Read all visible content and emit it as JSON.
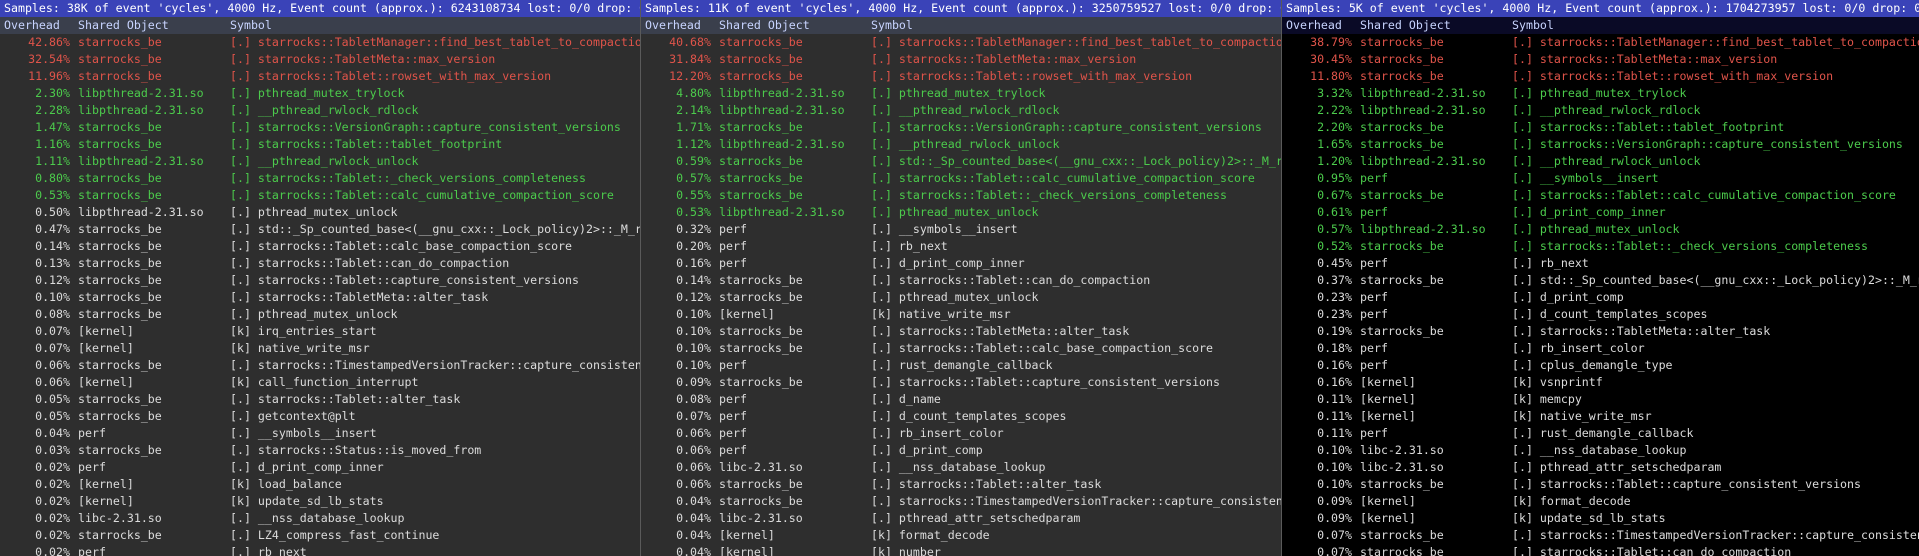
{
  "columns": {
    "overhead": "Overhead",
    "object": "Shared Object",
    "symbol": "Symbol"
  },
  "panes": [
    {
      "samples": "Samples: 38K of event 'cycles', 4000 Hz, Event count (approx.): 6243108734 lost: 0/0 drop: 0/0",
      "rows": [
        [
          "42.86%",
          "starrocks_be",
          "[.] starrocks::TabletManager::find_best_tablet_to_compaction",
          "red"
        ],
        [
          "32.54%",
          "starrocks_be",
          "[.] starrocks::TabletMeta::max_version",
          "red"
        ],
        [
          "11.96%",
          "starrocks_be",
          "[.] starrocks::Tablet::rowset_with_max_version",
          "red"
        ],
        [
          "2.30%",
          "libpthread-2.31.so",
          "[.] pthread_mutex_trylock",
          "green"
        ],
        [
          "2.28%",
          "libpthread-2.31.so",
          "[.] __pthread_rwlock_rdlock",
          "green"
        ],
        [
          "1.47%",
          "starrocks_be",
          "[.] starrocks::VersionGraph::capture_consistent_versions",
          "green"
        ],
        [
          "1.16%",
          "starrocks_be",
          "[.] starrocks::Tablet::tablet_footprint",
          "green"
        ],
        [
          "1.11%",
          "libpthread-2.31.so",
          "[.] __pthread_rwlock_unlock",
          "green"
        ],
        [
          "0.80%",
          "starrocks_be",
          "[.] starrocks::Tablet::_check_versions_completeness",
          "green"
        ],
        [
          "0.53%",
          "starrocks_be",
          "[.] starrocks::Tablet::calc_cumulative_compaction_score",
          "green"
        ],
        [
          "0.50%",
          "libpthread-2.31.so",
          "[.] pthread_mutex_unlock",
          "plain"
        ],
        [
          "0.47%",
          "starrocks_be",
          "[.] std::_Sp_counted_base<(__gnu_cxx::_Lock_policy)2>::_M_release",
          "plain"
        ],
        [
          "0.14%",
          "starrocks_be",
          "[.] starrocks::Tablet::calc_base_compaction_score",
          "plain"
        ],
        [
          "0.13%",
          "starrocks_be",
          "[.] starrocks::Tablet::can_do_compaction",
          "plain"
        ],
        [
          "0.12%",
          "starrocks_be",
          "[.] starrocks::Tablet::capture_consistent_versions",
          "plain"
        ],
        [
          "0.10%",
          "starrocks_be",
          "[.] starrocks::TabletMeta::alter_task",
          "plain"
        ],
        [
          "0.08%",
          "starrocks_be",
          "[.] pthread_mutex_unlock",
          "plain"
        ],
        [
          "0.07%",
          "[kernel]",
          "[k] irq_entries_start",
          "plain"
        ],
        [
          "0.07%",
          "[kernel]",
          "[k] native_write_msr",
          "plain"
        ],
        [
          "0.06%",
          "starrocks_be",
          "[.] starrocks::TimestampedVersionTracker::capture_consistent_versions",
          "plain"
        ],
        [
          "0.06%",
          "[kernel]",
          "[k] call_function_interrupt",
          "plain"
        ],
        [
          "0.05%",
          "starrocks_be",
          "[.] starrocks::Tablet::alter_task",
          "plain"
        ],
        [
          "0.05%",
          "starrocks_be",
          "[.] getcontext@plt",
          "plain"
        ],
        [
          "0.04%",
          "perf",
          "[.] __symbols__insert",
          "plain"
        ],
        [
          "0.03%",
          "starrocks_be",
          "[.] starrocks::Status::is_moved_from",
          "plain"
        ],
        [
          "0.02%",
          "perf",
          "[.] d_print_comp_inner",
          "plain"
        ],
        [
          "0.02%",
          "[kernel]",
          "[k] load_balance",
          "plain"
        ],
        [
          "0.02%",
          "[kernel]",
          "[k] update_sd_lb_stats",
          "plain"
        ],
        [
          "0.02%",
          "libc-2.31.so",
          "[.] __nss_database_lookup",
          "plain"
        ],
        [
          "0.02%",
          "starrocks_be",
          "[.] LZ4_compress_fast_continue",
          "plain"
        ],
        [
          "0.02%",
          "perf",
          "[.] rb_next",
          "plain"
        ]
      ]
    },
    {
      "samples": "Samples: 11K of event 'cycles', 4000 Hz, Event count (approx.): 3250759527 lost: 0/0 drop: 0/0",
      "rows": [
        [
          "40.68%",
          "starrocks_be",
          "[.] starrocks::TabletManager::find_best_tablet_to_compaction",
          "red"
        ],
        [
          "31.84%",
          "starrocks_be",
          "[.] starrocks::TabletMeta::max_version",
          "red"
        ],
        [
          "12.20%",
          "starrocks_be",
          "[.] starrocks::Tablet::rowset_with_max_version",
          "red"
        ],
        [
          "4.80%",
          "libpthread-2.31.so",
          "[.] pthread_mutex_trylock",
          "green"
        ],
        [
          "2.14%",
          "libpthread-2.31.so",
          "[.] __pthread_rwlock_rdlock",
          "green"
        ],
        [
          "1.71%",
          "starrocks_be",
          "[.] starrocks::VersionGraph::capture_consistent_versions",
          "green"
        ],
        [
          "1.12%",
          "libpthread-2.31.so",
          "[.] __pthread_rwlock_unlock",
          "green"
        ],
        [
          "0.59%",
          "starrocks_be",
          "[.] std::_Sp_counted_base<(__gnu_cxx::_Lock_policy)2>::_M_release",
          "green"
        ],
        [
          "0.57%",
          "starrocks_be",
          "[.] starrocks::Tablet::calc_cumulative_compaction_score",
          "green"
        ],
        [
          "0.55%",
          "starrocks_be",
          "[.] starrocks::Tablet::_check_versions_completeness",
          "green"
        ],
        [
          "0.53%",
          "libpthread-2.31.so",
          "[.] pthread_mutex_unlock",
          "green"
        ],
        [
          "0.32%",
          "perf",
          "[.] __symbols__insert",
          "plain"
        ],
        [
          "0.20%",
          "perf",
          "[.] rb_next",
          "plain"
        ],
        [
          "0.16%",
          "perf",
          "[.] d_print_comp_inner",
          "plain"
        ],
        [
          "0.14%",
          "starrocks_be",
          "[.] starrocks::Tablet::can_do_compaction",
          "plain"
        ],
        [
          "0.12%",
          "starrocks_be",
          "[.] pthread_mutex_unlock",
          "plain"
        ],
        [
          "0.10%",
          "[kernel]",
          "[k] native_write_msr",
          "plain"
        ],
        [
          "0.10%",
          "starrocks_be",
          "[.] starrocks::TabletMeta::alter_task",
          "plain"
        ],
        [
          "0.10%",
          "starrocks_be",
          "[.] starrocks::Tablet::calc_base_compaction_score",
          "plain"
        ],
        [
          "0.10%",
          "perf",
          "[.] rust_demangle_callback",
          "plain"
        ],
        [
          "0.09%",
          "starrocks_be",
          "[.] starrocks::Tablet::capture_consistent_versions",
          "plain"
        ],
        [
          "0.08%",
          "perf",
          "[.] d_name",
          "plain"
        ],
        [
          "0.07%",
          "perf",
          "[.] d_count_templates_scopes",
          "plain"
        ],
        [
          "0.06%",
          "perf",
          "[.] rb_insert_color",
          "plain"
        ],
        [
          "0.06%",
          "perf",
          "[.] d_print_comp",
          "plain"
        ],
        [
          "0.06%",
          "libc-2.31.so",
          "[.] __nss_database_lookup",
          "plain"
        ],
        [
          "0.06%",
          "starrocks_be",
          "[.] starrocks::Tablet::alter_task",
          "plain"
        ],
        [
          "0.04%",
          "starrocks_be",
          "[.] starrocks::TimestampedVersionTracker::capture_consistent_versions",
          "plain"
        ],
        [
          "0.04%",
          "libc-2.31.so",
          "[.] pthread_attr_setschedparam",
          "plain"
        ],
        [
          "0.04%",
          "[kernel]",
          "[k] format_decode",
          "plain"
        ],
        [
          "0.04%",
          "[kernel]",
          "[k] number",
          "plain"
        ]
      ]
    },
    {
      "samples": "Samples: 5K of event 'cycles', 4000 Hz, Event count (approx.): 1704273957 lost: 0/0 drop: 0/0",
      "rows": [
        [
          "38.79%",
          "starrocks_be",
          "[.] starrocks::TabletManager::find_best_tablet_to_compaction",
          "red"
        ],
        [
          "30.45%",
          "starrocks_be",
          "[.] starrocks::TabletMeta::max_version",
          "red"
        ],
        [
          "11.80%",
          "starrocks_be",
          "[.] starrocks::Tablet::rowset_with_max_version",
          "red"
        ],
        [
          "3.32%",
          "libpthread-2.31.so",
          "[.] pthread_mutex_trylock",
          "green"
        ],
        [
          "2.22%",
          "libpthread-2.31.so",
          "[.] __pthread_rwlock_rdlock",
          "green"
        ],
        [
          "2.20%",
          "starrocks_be",
          "[.] starrocks::Tablet::tablet_footprint",
          "green"
        ],
        [
          "1.65%",
          "starrocks_be",
          "[.] starrocks::VersionGraph::capture_consistent_versions",
          "green"
        ],
        [
          "1.20%",
          "libpthread-2.31.so",
          "[.] __pthread_rwlock_unlock",
          "green"
        ],
        [
          "0.95%",
          "perf",
          "[.] __symbols__insert",
          "green"
        ],
        [
          "0.67%",
          "starrocks_be",
          "[.] starrocks::Tablet::calc_cumulative_compaction_score",
          "green"
        ],
        [
          "0.61%",
          "perf",
          "[.] d_print_comp_inner",
          "green"
        ],
        [
          "0.57%",
          "libpthread-2.31.so",
          "[.] pthread_mutex_unlock",
          "green"
        ],
        [
          "0.52%",
          "starrocks_be",
          "[.] starrocks::Tablet::_check_versions_completeness",
          "green"
        ],
        [
          "0.45%",
          "perf",
          "[.] rb_next",
          "plain"
        ],
        [
          "0.37%",
          "starrocks_be",
          "[.] std::_Sp_counted_base<(__gnu_cxx::_Lock_policy)2>::_M_release",
          "plain"
        ],
        [
          "0.23%",
          "perf",
          "[.] d_print_comp",
          "plain"
        ],
        [
          "0.23%",
          "perf",
          "[.] d_count_templates_scopes",
          "plain"
        ],
        [
          "0.19%",
          "starrocks_be",
          "[.] starrocks::TabletMeta::alter_task",
          "plain"
        ],
        [
          "0.18%",
          "perf",
          "[.] rb_insert_color",
          "plain"
        ],
        [
          "0.16%",
          "perf",
          "[.] cplus_demangle_type",
          "plain"
        ],
        [
          "0.16%",
          "[kernel]",
          "[k] vsnprintf",
          "plain"
        ],
        [
          "0.11%",
          "[kernel]",
          "[k] memcpy",
          "plain"
        ],
        [
          "0.11%",
          "[kernel]",
          "[k] native_write_msr",
          "plain"
        ],
        [
          "0.11%",
          "perf",
          "[.] rust_demangle_callback",
          "plain"
        ],
        [
          "0.10%",
          "libc-2.31.so",
          "[.] __nss_database_lookup",
          "plain"
        ],
        [
          "0.10%",
          "libc-2.31.so",
          "[.] pthread_attr_setschedparam",
          "plain"
        ],
        [
          "0.10%",
          "starrocks_be",
          "[.] starrocks::Tablet::capture_consistent_versions",
          "plain"
        ],
        [
          "0.09%",
          "[kernel]",
          "[k] format_decode",
          "plain"
        ],
        [
          "0.09%",
          "[kernel]",
          "[k] update_sd_lb_stats",
          "plain"
        ],
        [
          "0.07%",
          "starrocks_be",
          "[.] starrocks::TimestampedVersionTracker::capture_consistent_versions",
          "plain"
        ],
        [
          "0.07%",
          "starrocks_be",
          "[.] starrocks::Tablet::can_do_compaction",
          "plain"
        ]
      ]
    }
  ]
}
